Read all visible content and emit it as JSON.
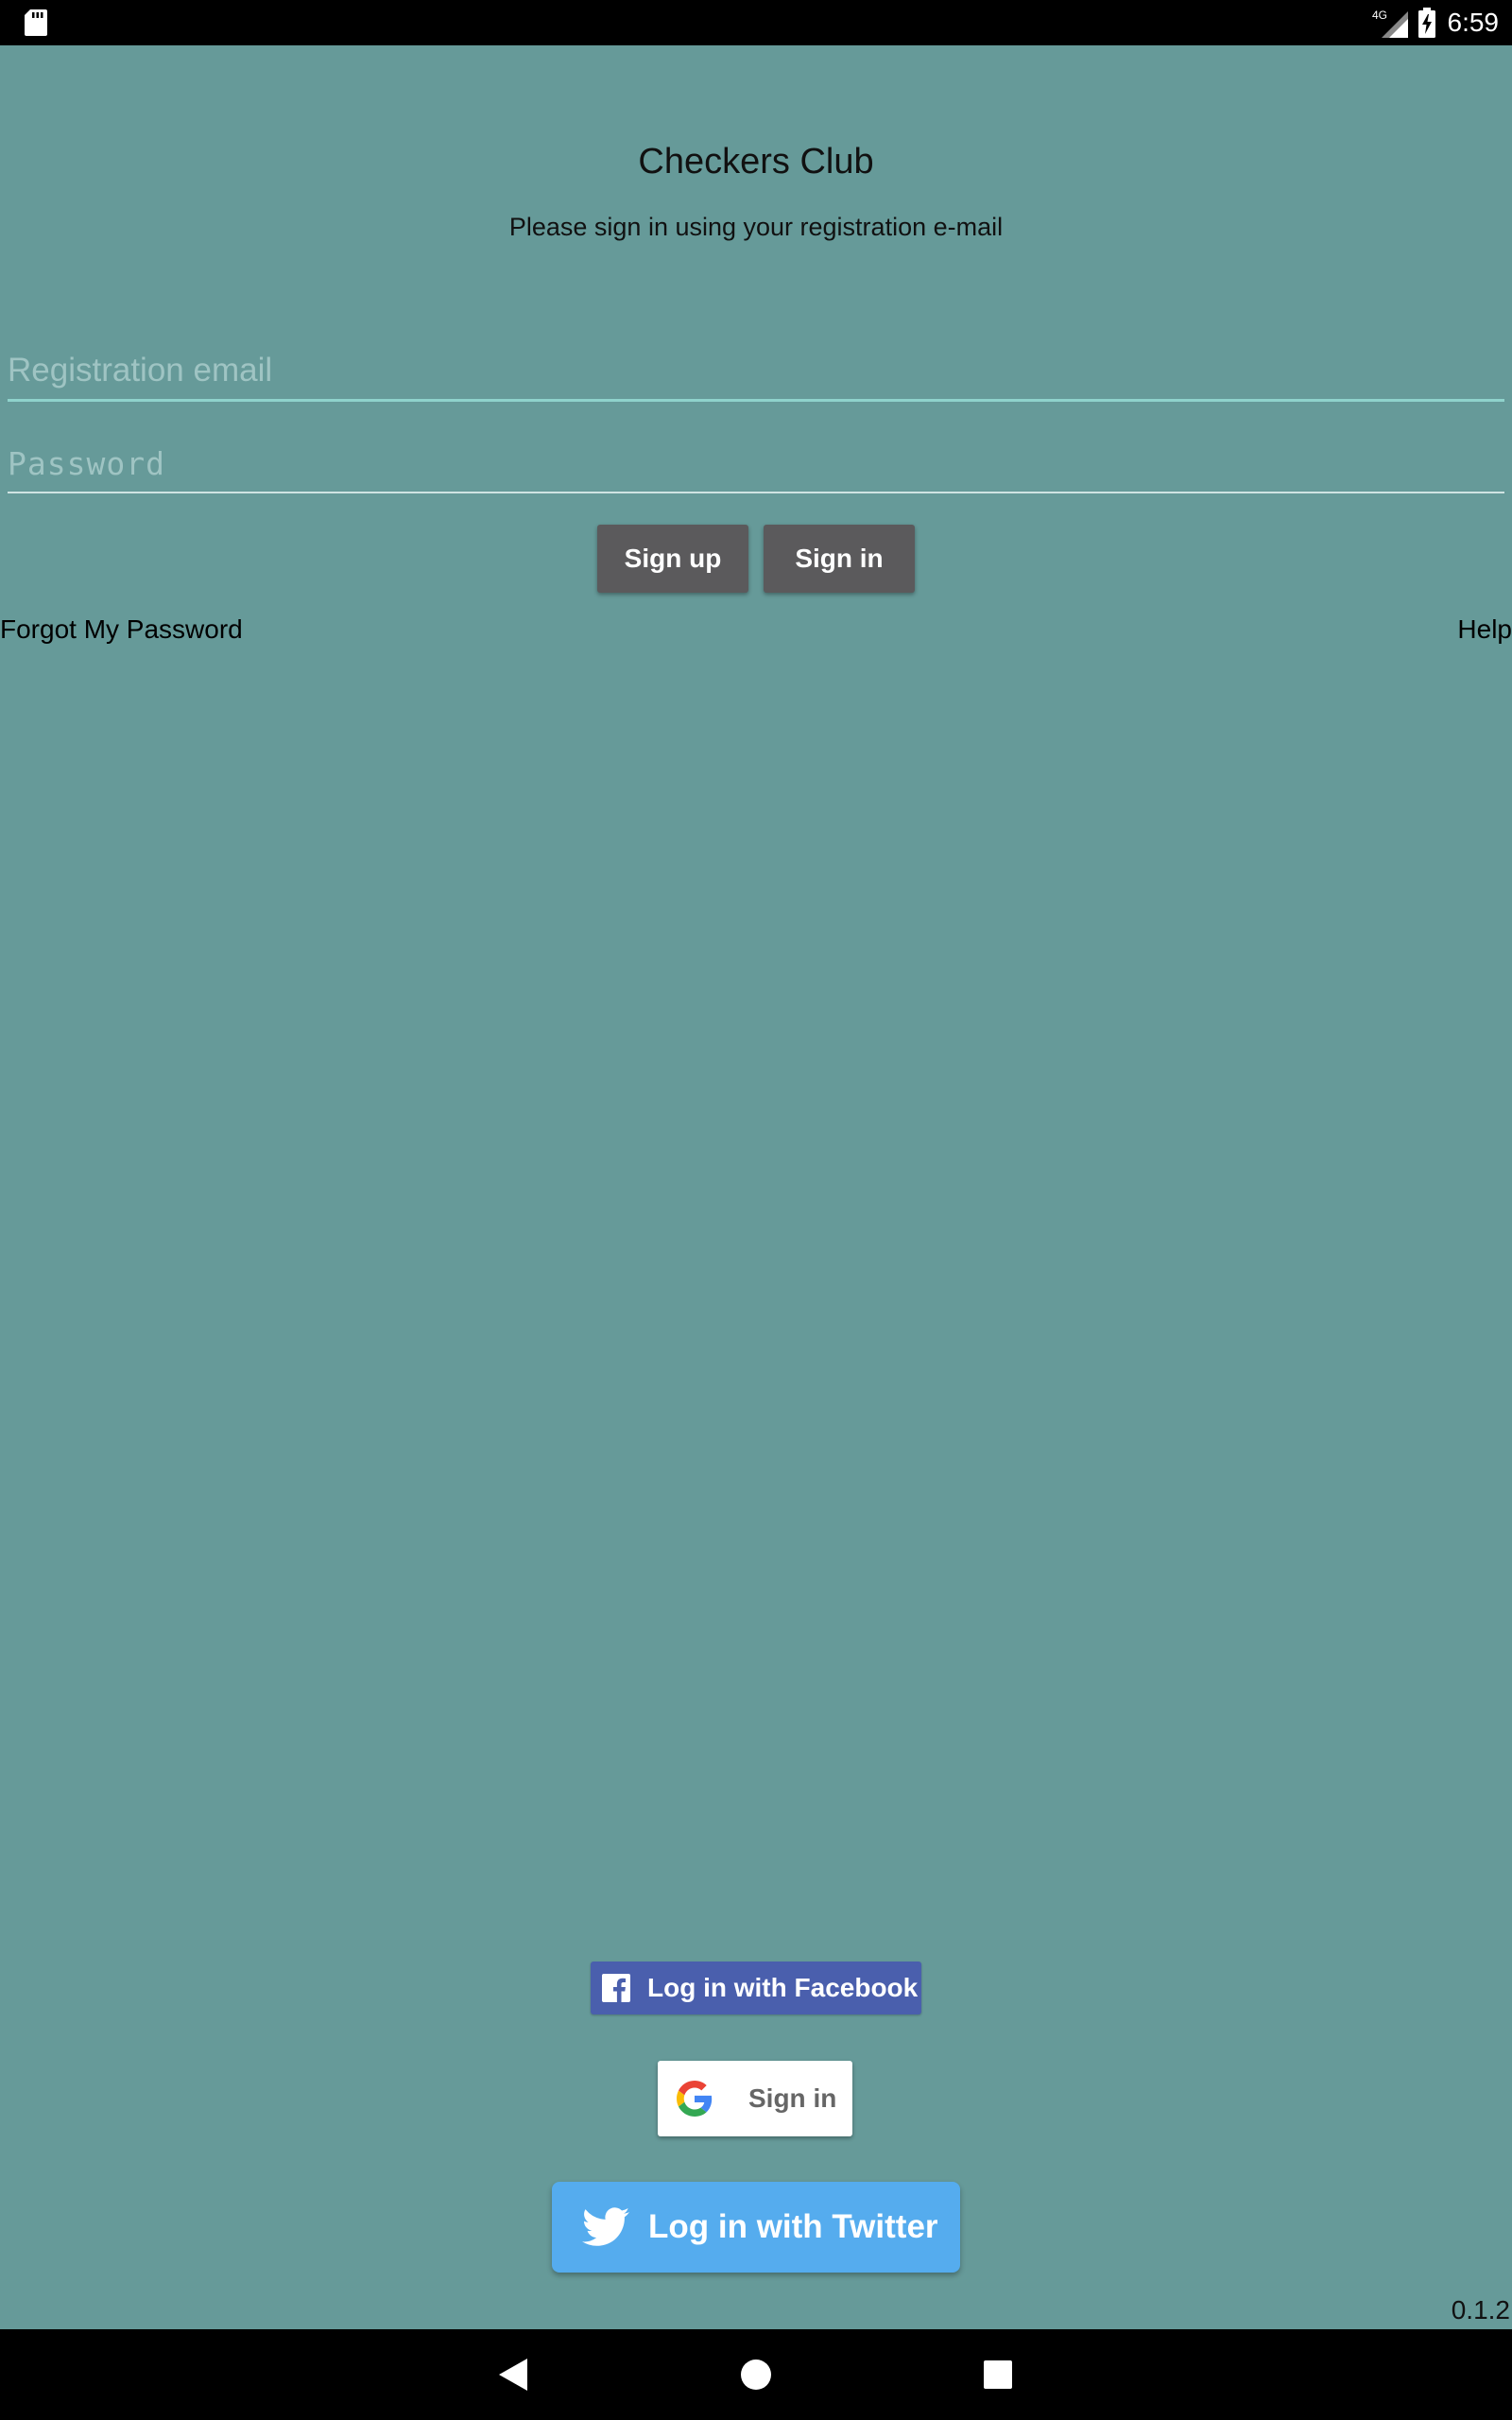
{
  "status_bar": {
    "network": "4G",
    "time": "6:59",
    "icons": [
      "sd-card-icon",
      "signal-icon",
      "battery-charging-icon"
    ]
  },
  "header": {
    "title": "Checkers Club",
    "subtitle": "Please sign in using your registration e-mail"
  },
  "form": {
    "email_placeholder": "Registration email",
    "email_value": "",
    "password_placeholder": "Password",
    "password_value": "",
    "signup_label": "Sign up",
    "signin_label": "Sign in"
  },
  "links": {
    "forgot_password": "Forgot My Password",
    "help": "Help"
  },
  "social": {
    "facebook_label": "Log in with Facebook",
    "google_label": "Sign in",
    "twitter_label": "Log in with Twitter"
  },
  "version": "0.1.2",
  "nav_bar": {
    "icons": [
      "back-icon",
      "home-icon",
      "recent-apps-icon"
    ]
  },
  "colors": {
    "background": "#669a99",
    "facebook": "#4a5fad",
    "twitter": "#55acee",
    "button_dark": "#5b5a5c",
    "field_underline_focus": "#8fd3cc"
  }
}
